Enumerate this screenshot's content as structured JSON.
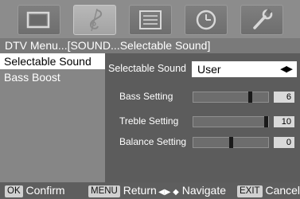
{
  "icons": [
    {
      "name": "picture-icon",
      "active": false
    },
    {
      "name": "sound-icon",
      "active": true
    },
    {
      "name": "channel-icon",
      "active": false
    },
    {
      "name": "clock-icon",
      "active": false
    },
    {
      "name": "setup-wrench-icon",
      "active": false
    }
  ],
  "title": "DTV Menu...[SOUND...Selectable Sound]",
  "left_menu": {
    "items": [
      {
        "label": "Selectable Sound",
        "selected": true
      },
      {
        "label": "Bass Boost",
        "selected": false
      }
    ]
  },
  "right_panel": {
    "selectable_sound": {
      "label": "Selectable Sound",
      "value": "User",
      "arrows": "◀▶"
    },
    "settings": [
      {
        "label": "Bass Setting",
        "value": "6",
        "level": 0.78
      },
      {
        "label": "Treble Setting",
        "value": "10",
        "level": 1.0
      },
      {
        "label": "Balance Setting",
        "value": "0",
        "level": 0.5
      }
    ]
  },
  "hint_bar": {
    "ok_key": "OK",
    "ok_text": "Confirm",
    "menu_key": "MENU",
    "menu_text": "Return",
    "nav_arrows": "◀▶ ◆",
    "nav_text": "Navigate",
    "exit_key": "EXIT",
    "exit_text": "Cancel"
  },
  "colors": {
    "background": "#8d8d8d",
    "panel": "#5c5c5c",
    "highlight": "#ffffff"
  }
}
